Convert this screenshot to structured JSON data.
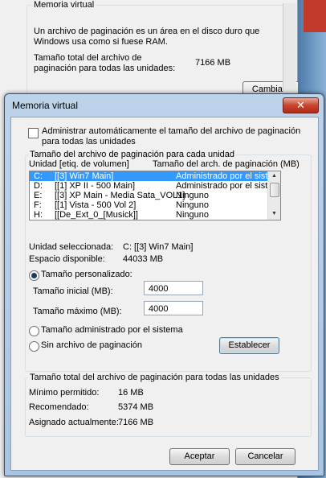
{
  "background_dialog": {
    "group_title": "Memoria virtual",
    "description": "Un archivo de paginación es un área en el disco duro que Windows usa como si fuese RAM.",
    "total_label": "Tamaño total del archivo de paginación para todas las unidades:",
    "total_value": "7166 MB",
    "change_button": "Cambiar..."
  },
  "dialog": {
    "title": "Memoria virtual",
    "close_glyph": "✕",
    "auto_manage_label": "Administrar automáticamente el tamaño del archivo de paginación para todas las unidades",
    "per_drive_group_title": "Tamaño del archivo de paginación para cada unidad",
    "list_headers": {
      "drive": "Unidad [etiq. de volumen]",
      "size": "Tamaño del arch. de paginación (MB)"
    },
    "drives": [
      {
        "letter": "C:",
        "label": "[[3] Win7 Main]",
        "size": "Administrado por el sistema"
      },
      {
        "letter": "D:",
        "label": "[[1] XP II - 500 Main]",
        "size": "Administrado por el sistema"
      },
      {
        "letter": "E:",
        "label": "[[3] XP Main - Media Sata_VOL1]",
        "size": "Ninguno"
      },
      {
        "letter": "F:",
        "label": "[[1] Vista - 500 Vol 2]",
        "size": "Ninguno"
      },
      {
        "letter": "H:",
        "label": "[[De_Ext_0_[Musick]]",
        "size": "Ninguno"
      }
    ],
    "selected_drive_label": "Unidad seleccionada:",
    "selected_drive_value": "C:  [[3] Win7 Main]",
    "free_space_label": "Espacio disponible:",
    "free_space_value": "44033 MB",
    "custom_size_label": "Tamaño personalizado:",
    "initial_size_label": "Tamaño inicial (MB):",
    "initial_size_value": "4000",
    "max_size_label": "Tamaño máximo (MB):",
    "max_size_value": "4000",
    "system_managed_label": "Tamaño administrado por el sistema",
    "no_paging_label": "Sin archivo de paginación",
    "set_button": "Establecer",
    "totals_group_title": "Tamaño total del archivo de paginación para todas las unidades",
    "min_label": "Mínimo permitido:",
    "min_value": "16 MB",
    "recommended_label": "Recomendado:",
    "recommended_value": "5374 MB",
    "allocated_label": "Asignado actualmente:",
    "allocated_value": "7166 MB",
    "ok_button": "Aceptar",
    "cancel_button": "Cancelar"
  },
  "colors": {
    "selection": "#3399ff",
    "close_button": "#c7452f",
    "title_bar": "#bcd3ea"
  }
}
